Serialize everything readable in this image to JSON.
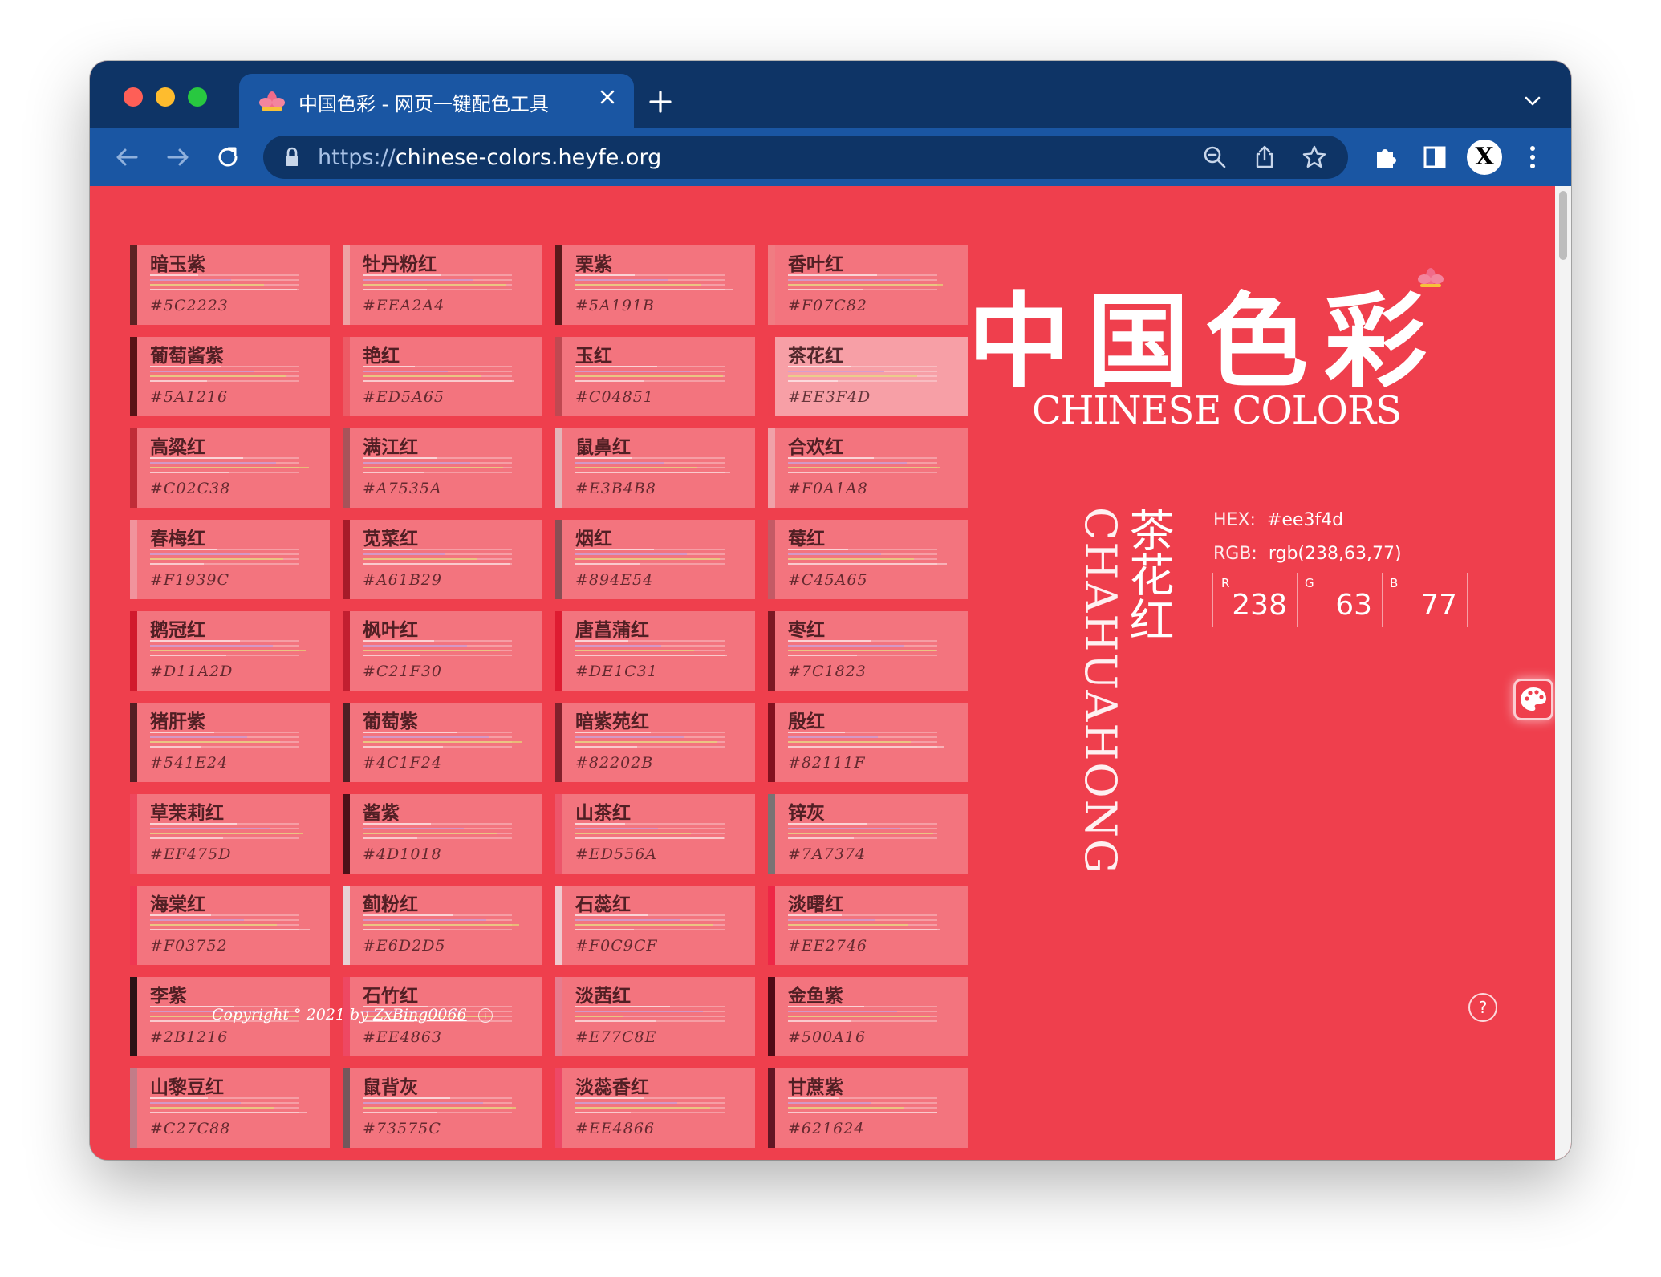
{
  "browser": {
    "tab_title": "中国色彩 - 网页一键配色工具",
    "url_scheme": "https://",
    "url_host": "chinese-colors.heyfe.org",
    "profile_letter": "X",
    "colors": {
      "tab_strip": "#0e3466",
      "toolbar": "#1a56a3",
      "omnibox": "#0e3466"
    },
    "icons": [
      "back-icon",
      "forward-icon",
      "reload-icon",
      "lock-icon",
      "zoom-icon",
      "share-icon",
      "bookmark-star-icon",
      "extensions-icon",
      "side-panel-icon",
      "menu-icon",
      "close-icon",
      "new-tab-icon",
      "chevron-down-icon"
    ]
  },
  "page": {
    "background": "#ef3f4d",
    "title_cn": "中国色彩",
    "title_en": "CHINESE COLORS",
    "selected": {
      "name": "茶花红",
      "pinyin": "CHAHUAHONG",
      "hex_label": "HEX:",
      "hex": "#ee3f4d",
      "rgb_label": "RGB:",
      "rgb": "rgb(238,63,77)",
      "channels": [
        {
          "label": "R",
          "value": "238"
        },
        {
          "label": "G",
          "value": "63"
        },
        {
          "label": "B",
          "value": "77"
        }
      ]
    },
    "colors": [
      {
        "name": "暗玉紫",
        "hex": "#5C2223"
      },
      {
        "name": "牡丹粉红",
        "hex": "#EEA2A4"
      },
      {
        "name": "栗紫",
        "hex": "#5A191B"
      },
      {
        "name": "香叶红",
        "hex": "#F07C82"
      },
      {
        "name": "葡萄酱紫",
        "hex": "#5A1216"
      },
      {
        "name": "艳红",
        "hex": "#ED5A65"
      },
      {
        "name": "玉红",
        "hex": "#C04851"
      },
      {
        "name": "茶花红",
        "hex": "#EE3F4D",
        "active": true
      },
      {
        "name": "高粱红",
        "hex": "#C02C38"
      },
      {
        "name": "满江红",
        "hex": "#A7535A"
      },
      {
        "name": "鼠鼻红",
        "hex": "#E3B4B8"
      },
      {
        "name": "合欢红",
        "hex": "#F0A1A8"
      },
      {
        "name": "春梅红",
        "hex": "#F1939C"
      },
      {
        "name": "苋菜红",
        "hex": "#A61B29"
      },
      {
        "name": "烟红",
        "hex": "#894E54"
      },
      {
        "name": "莓红",
        "hex": "#C45A65"
      },
      {
        "name": "鹅冠红",
        "hex": "#D11A2D"
      },
      {
        "name": "枫叶红",
        "hex": "#C21F30"
      },
      {
        "name": "唐菖蒲红",
        "hex": "#DE1C31"
      },
      {
        "name": "枣红",
        "hex": "#7C1823"
      },
      {
        "name": "猪肝紫",
        "hex": "#541E24"
      },
      {
        "name": "葡萄紫",
        "hex": "#4C1F24"
      },
      {
        "name": "暗紫苑红",
        "hex": "#82202B"
      },
      {
        "name": "殷红",
        "hex": "#82111F"
      },
      {
        "name": "草茉莉红",
        "hex": "#EF475D"
      },
      {
        "name": "酱紫",
        "hex": "#4D1018"
      },
      {
        "name": "山茶红",
        "hex": "#ED556A"
      },
      {
        "name": "锌灰",
        "hex": "#7A7374"
      },
      {
        "name": "海棠红",
        "hex": "#F03752"
      },
      {
        "name": "蓟粉红",
        "hex": "#E6D2D5"
      },
      {
        "name": "石蕊红",
        "hex": "#F0C9CF"
      },
      {
        "name": "淡曙红",
        "hex": "#EE2746"
      },
      {
        "name": "李紫",
        "hex": "#2B1216"
      },
      {
        "name": "石竹红",
        "hex": "#EE4863"
      },
      {
        "name": "淡茜红",
        "hex": "#E77C8E"
      },
      {
        "name": "金鱼紫",
        "hex": "#500A16"
      },
      {
        "name": "山黎豆红",
        "hex": "#C27C88"
      },
      {
        "name": "鼠背灰",
        "hex": "#73575C"
      },
      {
        "name": "淡蕊香红",
        "hex": "#EE4866"
      },
      {
        "name": "甘蔗紫",
        "hex": "#621624"
      }
    ],
    "copyright_prefix": "Copyright ° 2021 by ",
    "copyright_author": "ZxBing0066",
    "info_icon": "i",
    "help_icon": "?"
  }
}
